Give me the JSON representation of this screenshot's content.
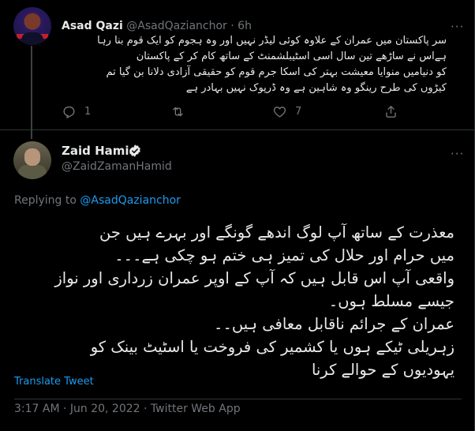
{
  "reply_tweet": {
    "name": "Asad Qazi",
    "handle": "@AsadQazianchor",
    "separator": "·",
    "time": "6h",
    "lines": [
      "سر پاکستان میں عمران کے علاوہ کوئی لیڈر نہیں اور وہ ہجوم کو ایک قوم بنا رہا",
      "ہےاس نے ساڑھے تین سال اسی اسٹیبلشمنٹ کے ساتھ کام کر کے پاکستان",
      "کو دنیامیں منوایا معیشت بہتر کی اسکا جرم قوم کو حقیقی آزادی دلانا بن گیا تم",
      "کیڑوں کی طرح رینگو وہ شاہین ہے وہ ڈرپوک نہیں بہادر ہے"
    ],
    "replies": "1",
    "retweets": "",
    "likes": "7"
  },
  "main_tweet": {
    "name": "Zaid Hamid",
    "handle": "@ZaidZamanHamid",
    "replying_prefix": "Replying to",
    "replying_to": "@AsadQazianchor",
    "lines": [
      "معذرت کے ساتھ آپ لوگ اندھے گونگے اور بہرے ہیں جن",
      "میں حرام اور حلال کی تمیز ہی ختم ہو چکی ہے۔۔۔",
      "واقعی آپ اس قابل ہیں کہ آپ کے اوپر عمران زرداری اور نواز",
      "جیسے مسلط ہوں۔",
      "عمران کے جرائم ناقابل معافی ہیں۔۔",
      "زہریلی ٹیکے ہوں یا کشمیر کی فروخت یا اسٹیٹ بینک کو",
      "یہودیوں کے حوالے کرنا"
    ],
    "translate_label": "Translate Tweet",
    "meta": "3:17 AM · Jun 20, 2022 · Twitter Web App"
  },
  "colors": {
    "background": "#000000",
    "text": "#e7e9ea",
    "secondary": "#71767b",
    "accent": "#1d9bf0",
    "border": "#2f3336"
  }
}
